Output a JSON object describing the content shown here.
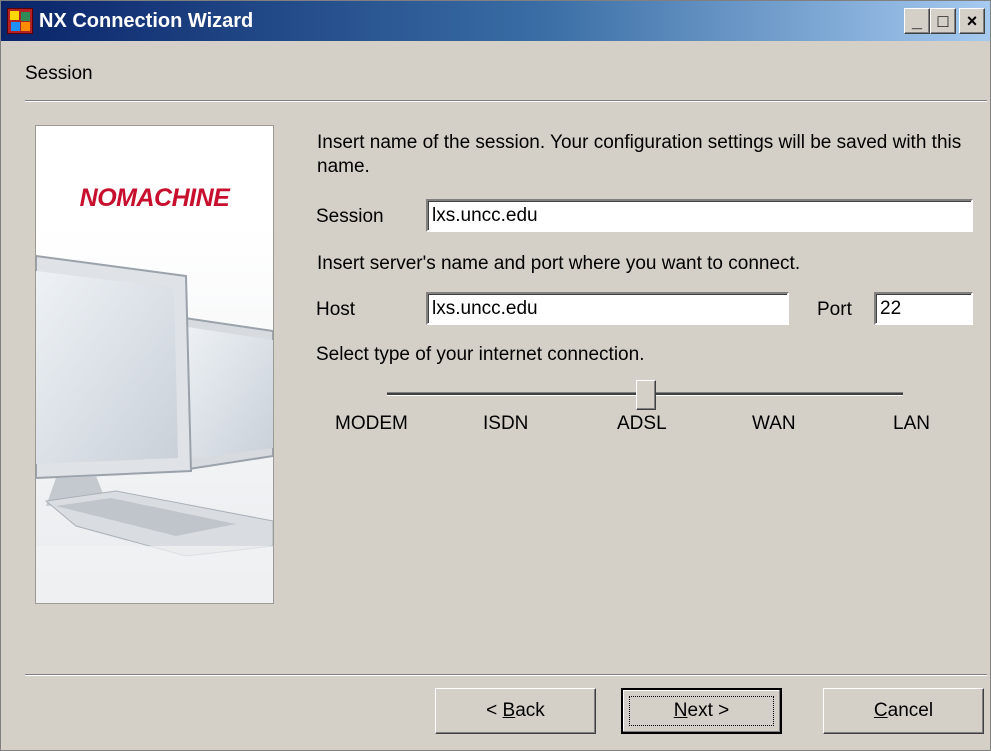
{
  "window": {
    "title": "NX Connection Wizard",
    "min_label": "_",
    "max_label": "□",
    "close_label": "×"
  },
  "page": {
    "section_title": "Session"
  },
  "side_panel": {
    "logo_text": "NOMACHINE"
  },
  "form": {
    "session_instructions": "Insert name of the session. Your configuration settings will be saved with this name.",
    "session_label": "Session",
    "session_value": "lxs.uncc.edu",
    "server_instructions": "Insert server's name and port where you want to connect.",
    "host_label": "Host",
    "host_value": "lxs.uncc.edu",
    "port_label": "Port",
    "port_value": "22",
    "connection_instructions": "Select type of your internet connection.",
    "connection_types": [
      "MODEM",
      "ISDN",
      "ADSL",
      "WAN",
      "LAN"
    ],
    "connection_selected": "ADSL"
  },
  "buttons": {
    "back": {
      "label": "< ",
      "mnemonic": "B",
      "rest": "ack"
    },
    "next": {
      "mnemonic": "N",
      "rest": "ext >"
    },
    "cancel": {
      "mnemonic": "C",
      "rest": "ancel"
    }
  }
}
